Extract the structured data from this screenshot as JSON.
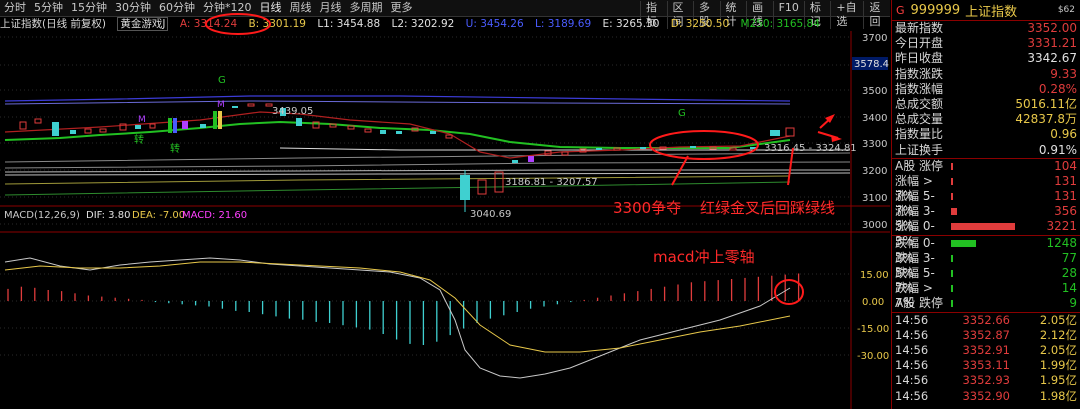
{
  "toolbar": {
    "tabs": [
      "分时",
      "5分钟",
      "15分钟",
      "30分钟",
      "60分钟",
      "分钟*120",
      "日线",
      "周线",
      "月线",
      "多周期",
      "更多"
    ],
    "active_tab": "日线",
    "right_tools": [
      "指标",
      "区间",
      "多股",
      "统计",
      "画线",
      "F10",
      "标记",
      "+自选",
      "返回"
    ]
  },
  "chart_info": {
    "name": "上证指数(日线 前复权)",
    "indicator": "黄金游戏J",
    "a": "A: 3314.24",
    "b": "B: 3301.19",
    "l1": "L1: 3454.88",
    "l2": "L2: 3202.92",
    "u": "U: 3454.26",
    "l": "L: 3189.69",
    "e": "E: 3265.30",
    "d": "D: 3250.50",
    "m250": "M250: 3165.84"
  },
  "price_axis": [
    "3700",
    "3600",
    "3500",
    "3400",
    "3300",
    "3200",
    "3100",
    "3000"
  ],
  "price_box": "3578.4",
  "macd_info": {
    "name": "MACD(12,26,9)",
    "dif": "DIF: 3.80",
    "dea": "DEA: -7.00",
    "macd": "MACD: 21.60"
  },
  "macd_axis": [
    "15.00",
    "0.00",
    "-15.00",
    "-30.00"
  ],
  "chart_labels": {
    "high_mark": "3439.05",
    "low_mark": "3040.69",
    "mid_mark": "3186.81 - 3207.57",
    "right_mark": "3316.45 - 3324.81",
    "g1": "G",
    "g2": "G",
    "m1": "M",
    "m2": "M",
    "zhuan1": "转",
    "zhuan2": "转"
  },
  "annotations": {
    "a1": "3300争夺",
    "a2": "红绿金叉后回踩绿线",
    "a3": "macd冲上零轴"
  },
  "panel": {
    "code": "999999",
    "name": "上证指数",
    "tag": "$62",
    "quote": [
      {
        "label": "最新指数",
        "value": "3352.00",
        "color": "#e03c3c"
      },
      {
        "label": "今日开盘",
        "value": "3331.21",
        "color": "#e03c3c"
      },
      {
        "label": "昨日收盘",
        "value": "3342.67",
        "color": "#e0e0e0"
      },
      {
        "label": "指数涨跌",
        "value": "9.33",
        "color": "#e03c3c"
      },
      {
        "label": "指数涨幅",
        "value": "0.28%",
        "color": "#e03c3c"
      },
      {
        "label": "总成交额",
        "value": "5016.11亿",
        "color": "#e8c84a"
      },
      {
        "label": "总成交量",
        "value": "42837.8万",
        "color": "#e8c84a"
      },
      {
        "label": "指数量比",
        "value": "0.96",
        "color": "#e8c84a"
      },
      {
        "label": "上证换手",
        "value": "0.91%",
        "color": "#e0e0e0"
      }
    ],
    "dist": [
      {
        "label": "A股 涨停",
        "value": "104",
        "color": "#e03c3c",
        "frac": 0.03
      },
      {
        "label": "涨幅 > 7%",
        "value": "131",
        "color": "#e03c3c",
        "frac": 0.03
      },
      {
        "label": "涨幅 5-7%",
        "value": "131",
        "color": "#e03c3c",
        "frac": 0.03
      },
      {
        "label": "涨幅 3-5%",
        "value": "356",
        "color": "#e03c3c",
        "frac": 0.1
      },
      {
        "label": "涨幅 0-3%",
        "value": "3221",
        "color": "#e03c3c",
        "frac": 1.0
      },
      {
        "label": "跌幅 0-3%",
        "value": "1248",
        "color": "#22c022",
        "frac": 0.39
      },
      {
        "label": "跌幅 3-5%",
        "value": "77",
        "color": "#22c022",
        "frac": 0.02
      },
      {
        "label": "跌幅 5-7%",
        "value": "28",
        "color": "#22c022",
        "frac": 0.01
      },
      {
        "label": "跌幅 > 7%",
        "value": "14",
        "color": "#22c022",
        "frac": 0.01
      },
      {
        "label": "A股 跌停",
        "value": "9",
        "color": "#22c022",
        "frac": 0.0
      }
    ],
    "ticks": [
      {
        "time": "14:56",
        "price": "3352.66",
        "amount": "2.05亿"
      },
      {
        "time": "14:56",
        "price": "3352.87",
        "amount": "2.12亿"
      },
      {
        "time": "14:56",
        "price": "3352.91",
        "amount": "2.05亿"
      },
      {
        "time": "14:56",
        "price": "3353.11",
        "amount": "1.99亿"
      },
      {
        "time": "14:56",
        "price": "3352.93",
        "amount": "1.95亿"
      },
      {
        "time": "14:56",
        "price": "3352.90",
        "amount": "1.98亿"
      }
    ]
  }
}
